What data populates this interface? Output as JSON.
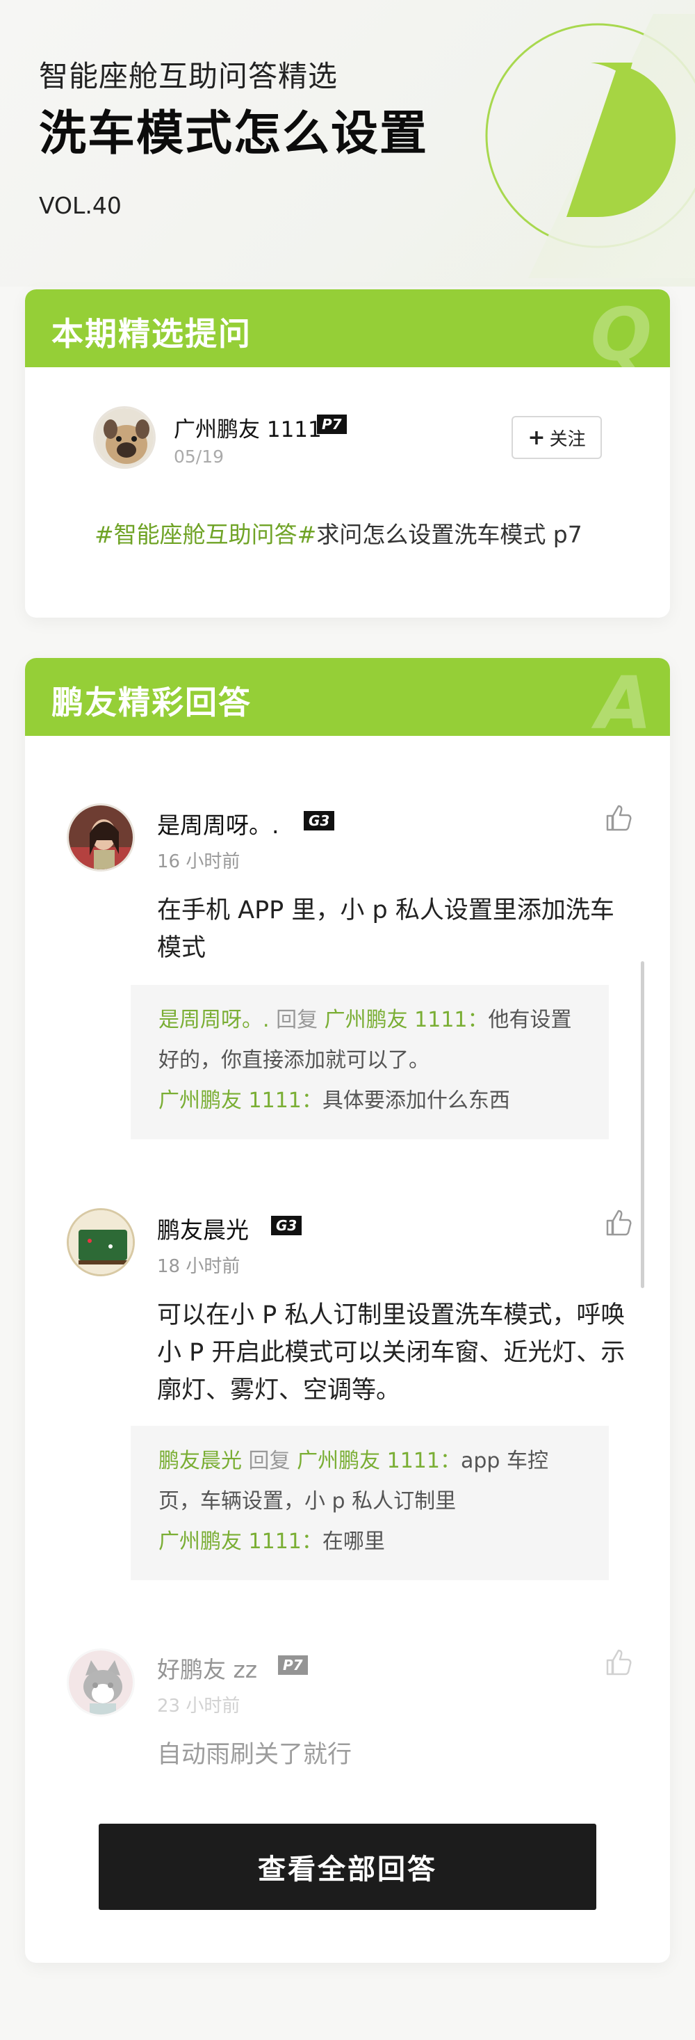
{
  "header": {
    "subtitle": "智能座舱互助问答精选",
    "title": "洗车模式怎么设置",
    "vol": "VOL.40"
  },
  "question_card": {
    "head_title": "本期精选提问",
    "head_letter": "Q",
    "user": {
      "name": "广州鹏友 1111",
      "badge": "P7",
      "date": "05/19"
    },
    "follow_label": "关注",
    "tag": "#智能座舱互助问答#",
    "question": "求问怎么设置洗车模式 p7"
  },
  "answers_card": {
    "head_title": "鹏友精彩回答",
    "head_letter": "A",
    "answers": [
      {
        "name": "是周周呀。.",
        "badge": "G3",
        "time": "16 小时前",
        "text": "在手机 APP 里，小 p 私人设置里添加洗车模式",
        "replies": [
          {
            "from": "是周周呀。.",
            "verb": " 回复 ",
            "to": "广州鹏友 1111：",
            "text": "他有设置好的，你直接添加就可以了。"
          },
          {
            "from": "广州鹏友 1111：",
            "text": "具体要添加什么东西"
          }
        ]
      },
      {
        "name": "鹏友晨光",
        "badge": "G3",
        "time": "18 小时前",
        "text": "可以在小 P 私人订制里设置洗车模式，呼唤小 P 开启此模式可以关闭车窗、近光灯、示廓灯、雾灯、空调等。",
        "replies": [
          {
            "from": "鹏友晨光",
            "verb": " 回复 ",
            "to": "广州鹏友 1111：",
            "text": "app 车控页，车辆设置，小 p 私人订制里"
          },
          {
            "from": "广州鹏友 1111：",
            "text": "在哪里"
          }
        ]
      },
      {
        "name": "好鹏友 zz",
        "badge": "P7",
        "time": "23 小时前",
        "text": "自动雨刷关了就行"
      }
    ],
    "view_all_label": "查看全部回答"
  },
  "colors": {
    "accent": "#95cf37",
    "tag_green": "#6fa326",
    "button_dark": "#1c1c1c"
  }
}
